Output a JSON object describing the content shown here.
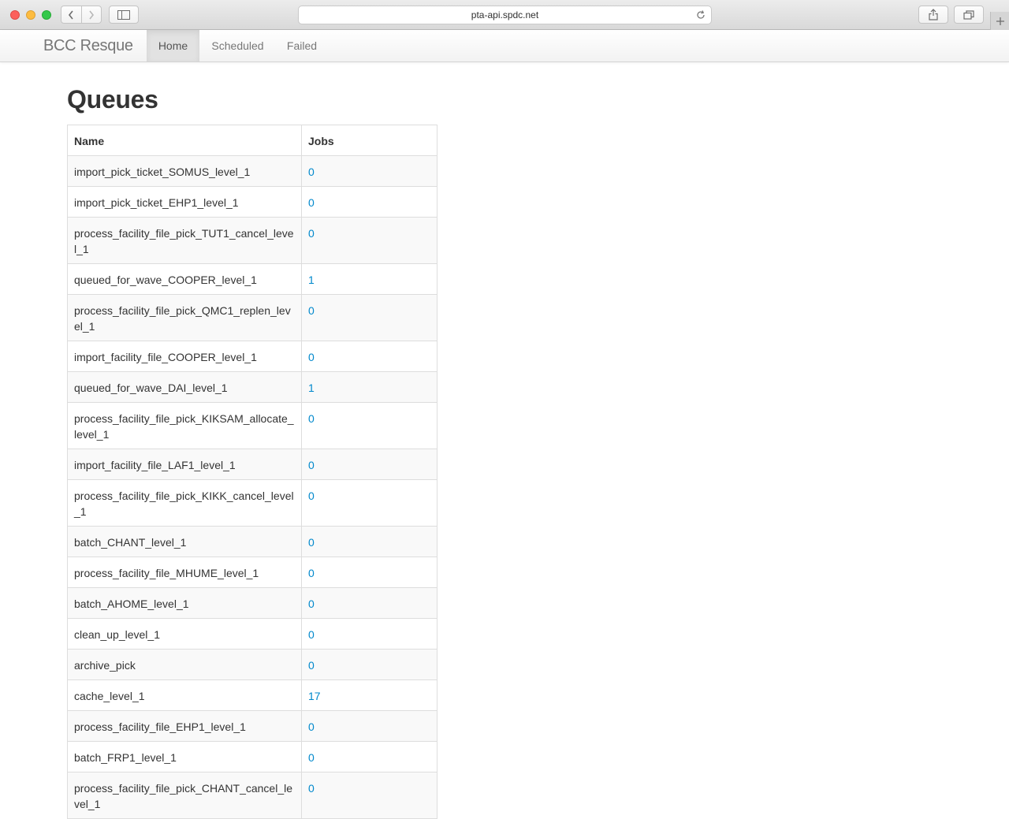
{
  "browser": {
    "url": "pta-api.spdc.net"
  },
  "navbar": {
    "brand": "BCC Resque",
    "tabs": {
      "home": "Home",
      "scheduled": "Scheduled",
      "failed": "Failed"
    },
    "active_tab": "Home"
  },
  "page": {
    "title": "Queues"
  },
  "table": {
    "headers": {
      "name": "Name",
      "jobs": "Jobs"
    },
    "rows": [
      {
        "name": "import_pick_ticket_SOMUS_level_1",
        "jobs": "0"
      },
      {
        "name": "import_pick_ticket_EHP1_level_1",
        "jobs": "0"
      },
      {
        "name": "process_facility_file_pick_TUT1_cancel_level_1",
        "jobs": "0"
      },
      {
        "name": "queued_for_wave_COOPER_level_1",
        "jobs": "1"
      },
      {
        "name": "process_facility_file_pick_QMC1_replen_level_1",
        "jobs": "0"
      },
      {
        "name": "import_facility_file_COOPER_level_1",
        "jobs": "0"
      },
      {
        "name": "queued_for_wave_DAI_level_1",
        "jobs": "1"
      },
      {
        "name": "process_facility_file_pick_KIKSAM_allocate_level_1",
        "jobs": "0"
      },
      {
        "name": "import_facility_file_LAF1_level_1",
        "jobs": "0"
      },
      {
        "name": "process_facility_file_pick_KIKK_cancel_level_1",
        "jobs": "0"
      },
      {
        "name": "batch_CHANT_level_1",
        "jobs": "0"
      },
      {
        "name": "process_facility_file_MHUME_level_1",
        "jobs": "0"
      },
      {
        "name": "batch_AHOME_level_1",
        "jobs": "0"
      },
      {
        "name": "clean_up_level_1",
        "jobs": "0"
      },
      {
        "name": "archive_pick",
        "jobs": "0"
      },
      {
        "name": "cache_level_1",
        "jobs": "17"
      },
      {
        "name": "process_facility_file_EHP1_level_1",
        "jobs": "0"
      },
      {
        "name": "batch_FRP1_level_1",
        "jobs": "0"
      },
      {
        "name": "process_facility_file_pick_CHANT_cancel_level_1",
        "jobs": "0"
      }
    ]
  },
  "colors": {
    "link": "#0088cc",
    "text": "#333333",
    "stripe": "#f9f9f9",
    "border": "#dddddd"
  }
}
